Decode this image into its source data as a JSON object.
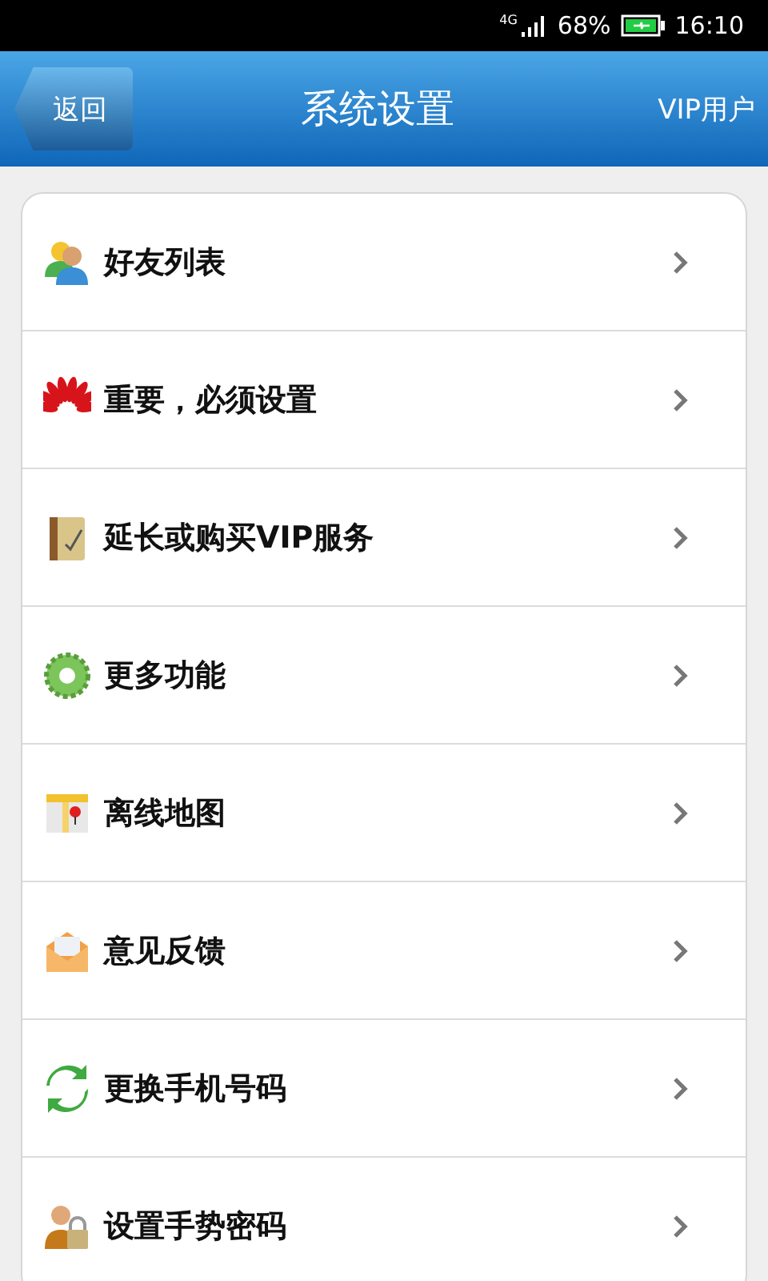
{
  "status_bar": {
    "network": "4G",
    "battery_percent": "68%",
    "time": "16:10"
  },
  "header": {
    "back": "返回",
    "title": "系统设置",
    "right": "VIP用户"
  },
  "items": [
    {
      "label": "好友列表",
      "kind": "contacts"
    },
    {
      "label": "重要，必须设置",
      "kind": "flower"
    },
    {
      "label": "延长或购买VIP服务",
      "kind": "notebook"
    },
    {
      "label": "更多功能",
      "kind": "gear"
    },
    {
      "label": "离线地图",
      "kind": "map"
    },
    {
      "label": "意见反馈",
      "kind": "envelope"
    },
    {
      "label": "更换手机号码",
      "kind": "refresh"
    },
    {
      "label": "设置手势密码",
      "kind": "lock"
    }
  ]
}
